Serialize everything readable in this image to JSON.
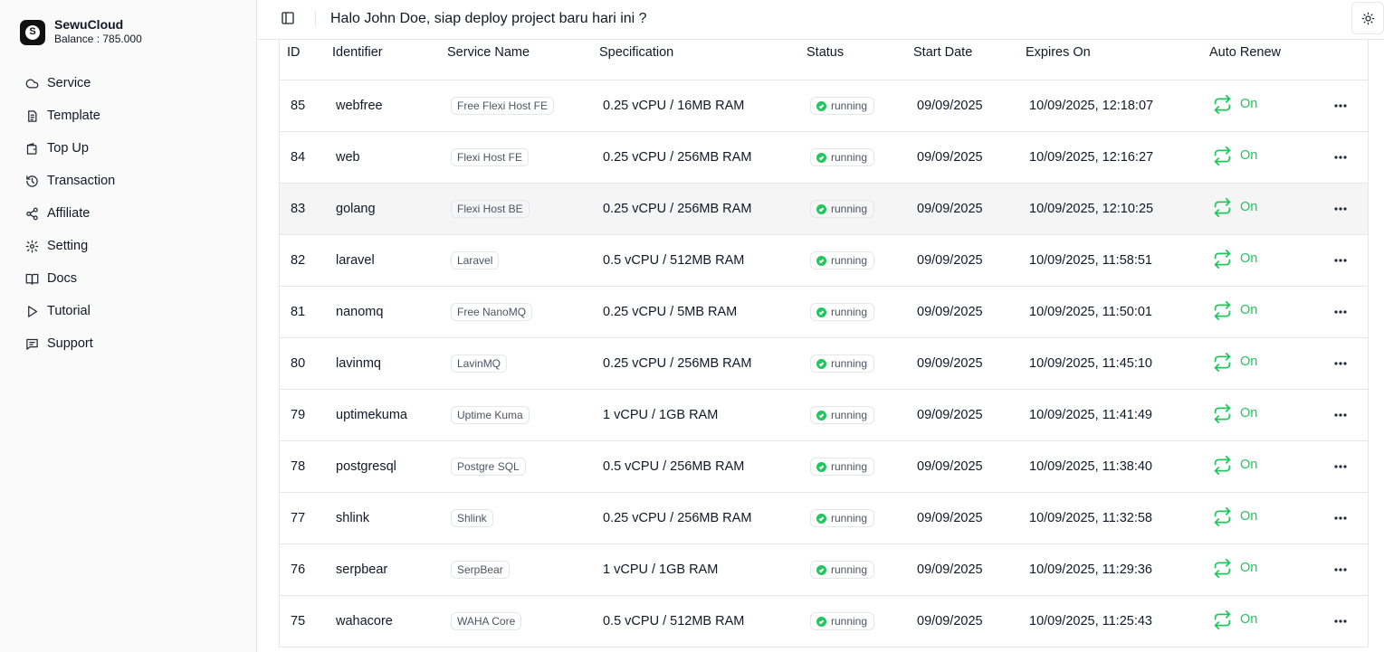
{
  "app": {
    "name": "SewuCloud",
    "balance": "Balance : 785.000",
    "logo_letter": "S"
  },
  "sidebar": {
    "items": [
      {
        "label": "Service",
        "icon": "cloud-icon"
      },
      {
        "label": "Template",
        "icon": "template-icon"
      },
      {
        "label": "Top Up",
        "icon": "wallet-icon"
      },
      {
        "label": "Transaction",
        "icon": "history-icon"
      },
      {
        "label": "Affiliate",
        "icon": "share-icon"
      },
      {
        "label": "Setting",
        "icon": "gear-icon"
      },
      {
        "label": "Docs",
        "icon": "book-icon"
      },
      {
        "label": "Tutorial",
        "icon": "play-icon"
      },
      {
        "label": "Support",
        "icon": "message-icon"
      }
    ]
  },
  "header": {
    "greeting": "Halo John Doe, siap deploy project baru hari ini ?"
  },
  "table": {
    "columns": [
      "ID",
      "Identifier",
      "Service Name",
      "Specification",
      "Status",
      "Start Date",
      "Expires On",
      "Auto Renew"
    ],
    "rows": [
      {
        "id": "85",
        "identifier": "webfree",
        "service": "Free Flexi Host FE",
        "spec": "0.25 vCPU / 16MB RAM",
        "status": "running",
        "start": "09/09/2025",
        "expires": "10/09/2025, 12:18:07",
        "renew": "On"
      },
      {
        "id": "84",
        "identifier": "web",
        "service": "Flexi Host FE",
        "spec": "0.25 vCPU / 256MB RAM",
        "status": "running",
        "start": "09/09/2025",
        "expires": "10/09/2025, 12:16:27",
        "renew": "On"
      },
      {
        "id": "83",
        "identifier": "golang",
        "service": "Flexi Host BE",
        "spec": "0.25 vCPU / 256MB RAM",
        "status": "running",
        "start": "09/09/2025",
        "expires": "10/09/2025, 12:10:25",
        "renew": "On"
      },
      {
        "id": "82",
        "identifier": "laravel",
        "service": "Laravel",
        "spec": "0.5 vCPU / 512MB RAM",
        "status": "running",
        "start": "09/09/2025",
        "expires": "10/09/2025, 11:58:51",
        "renew": "On"
      },
      {
        "id": "81",
        "identifier": "nanomq",
        "service": "Free NanoMQ",
        "spec": "0.25 vCPU / 5MB RAM",
        "status": "running",
        "start": "09/09/2025",
        "expires": "10/09/2025, 11:50:01",
        "renew": "On"
      },
      {
        "id": "80",
        "identifier": "lavinmq",
        "service": "LavinMQ",
        "spec": "0.25 vCPU / 256MB RAM",
        "status": "running",
        "start": "09/09/2025",
        "expires": "10/09/2025, 11:45:10",
        "renew": "On"
      },
      {
        "id": "79",
        "identifier": "uptimekuma",
        "service": "Uptime Kuma",
        "spec": "1 vCPU / 1GB RAM",
        "status": "running",
        "start": "09/09/2025",
        "expires": "10/09/2025, 11:41:49",
        "renew": "On"
      },
      {
        "id": "78",
        "identifier": "postgresql",
        "service": "Postgre SQL",
        "spec": "0.5 vCPU / 256MB RAM",
        "status": "running",
        "start": "09/09/2025",
        "expires": "10/09/2025, 11:38:40",
        "renew": "On"
      },
      {
        "id": "77",
        "identifier": "shlink",
        "service": "Shlink",
        "spec": "0.25 vCPU / 256MB RAM",
        "status": "running",
        "start": "09/09/2025",
        "expires": "10/09/2025, 11:32:58",
        "renew": "On"
      },
      {
        "id": "76",
        "identifier": "serpbear",
        "service": "SerpBear",
        "spec": "1 vCPU / 1GB RAM",
        "status": "running",
        "start": "09/09/2025",
        "expires": "10/09/2025, 11:29:36",
        "renew": "On"
      },
      {
        "id": "75",
        "identifier": "wahacore",
        "service": "WAHA Core",
        "spec": "0.5 vCPU / 512MB RAM",
        "status": "running",
        "start": "09/09/2025",
        "expires": "10/09/2025, 11:25:43",
        "renew": "On"
      }
    ]
  },
  "colors": {
    "status_running": "#22c55e",
    "auto_renew_on": "#22c55e",
    "row_highlight": "#f5f5f5"
  }
}
